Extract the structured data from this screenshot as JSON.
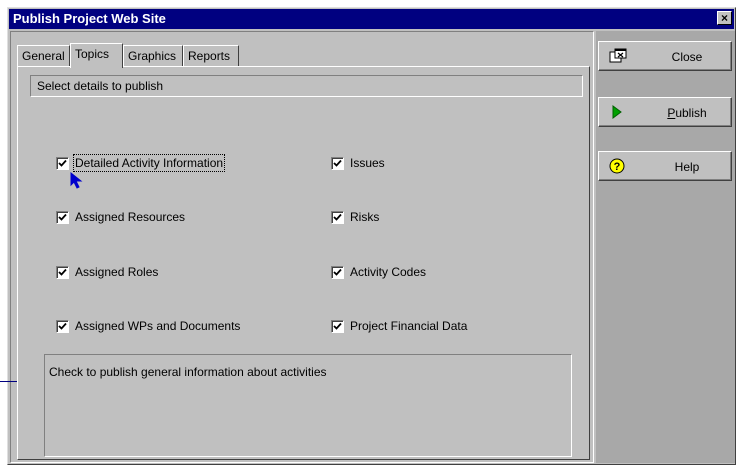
{
  "window": {
    "title": "Publish Project Web Site",
    "close_glyph": "×"
  },
  "tabs": [
    {
      "label": "General",
      "active": false
    },
    {
      "label": "Topics",
      "active": true
    },
    {
      "label": "Graphics",
      "active": false
    },
    {
      "label": "Reports",
      "active": false
    }
  ],
  "group": {
    "header": "Select details to publish"
  },
  "checkboxes": [
    {
      "label": "Detailed Activity Information",
      "checked": true,
      "focused": true
    },
    {
      "label": "Assigned Resources",
      "checked": true
    },
    {
      "label": "Assigned Roles",
      "checked": true
    },
    {
      "label": "Assigned WPs and Documents",
      "checked": true
    },
    {
      "label": "Issues",
      "checked": true
    },
    {
      "label": "Risks",
      "checked": true
    },
    {
      "label": "Activity Codes",
      "checked": true
    },
    {
      "label": "Project Financial Data",
      "checked": true
    }
  ],
  "description": "Check to publish general information about activities",
  "buttons": {
    "close": {
      "label": "Close",
      "icon": "close-window-icon"
    },
    "publish": {
      "label": "Publish",
      "icon": "play-arrow-icon",
      "accent": "#00a000"
    },
    "help": {
      "label": "Help",
      "icon": "question-mark-icon",
      "accent": "#ffff00"
    }
  },
  "colors": {
    "titlebar": "#000080",
    "callout": "#0000cc"
  }
}
